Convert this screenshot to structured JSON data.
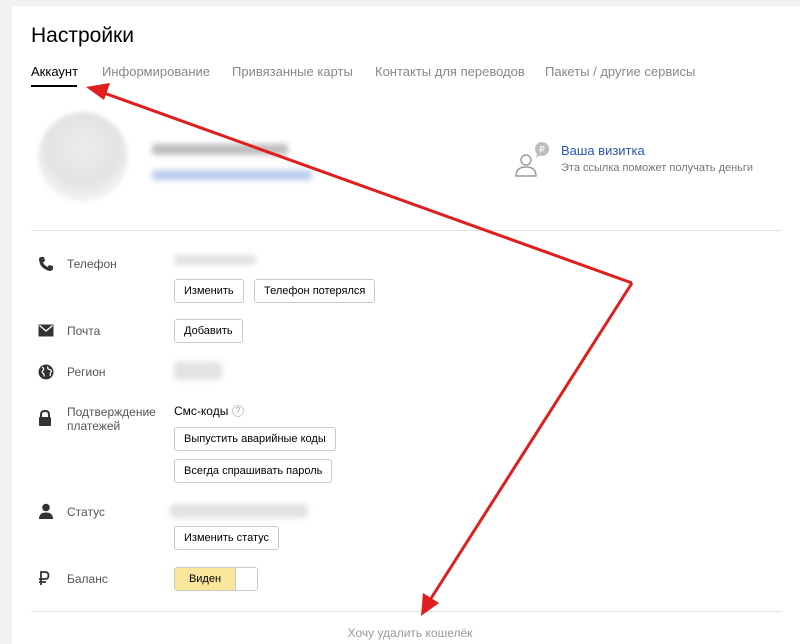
{
  "page": {
    "title": "Настройки"
  },
  "tabs": [
    {
      "label": "Аккаунт",
      "active": true
    },
    {
      "label": "Информирование",
      "active": false
    },
    {
      "label": "Привязанные карты",
      "active": false
    },
    {
      "label": "Контакты для переводов",
      "active": false
    },
    {
      "label": "Пакеты / другие сервисы",
      "active": false
    }
  ],
  "visit_card": {
    "link": "Ваша визитка",
    "hint": "Эта ссылка поможет получать деньги",
    "icon": "person-ruble-icon"
  },
  "rows": {
    "phone": {
      "label": "Телефон",
      "icon": "phone-icon",
      "change_button": "Изменить",
      "lost_button": "Телефон потерялся"
    },
    "email": {
      "label": "Почта",
      "icon": "mail-icon",
      "add_button": "Добавить"
    },
    "region": {
      "label": "Регион",
      "icon": "globe-icon"
    },
    "payment_confirm": {
      "label": "Подтверждение платежей",
      "icon": "lock-icon",
      "sms_label": "Смс-коды",
      "help": "?",
      "emergency_button": "Выпустить аварийные коды",
      "always_ask_button": "Всегда спрашивать пароль"
    },
    "status": {
      "label": "Статус",
      "icon": "user-icon",
      "change_button": "Изменить статус"
    },
    "balance": {
      "label": "Баланс",
      "icon": "ruble-icon",
      "toggle_on_label": "Виден",
      "visible": true
    }
  },
  "footer": {
    "delete_link": "Хочу удалить кошелёк"
  },
  "colors": {
    "accent_link": "#2a55b8",
    "toggle_active": "#fbe79b",
    "annotation_arrow": "#e01e1e"
  }
}
